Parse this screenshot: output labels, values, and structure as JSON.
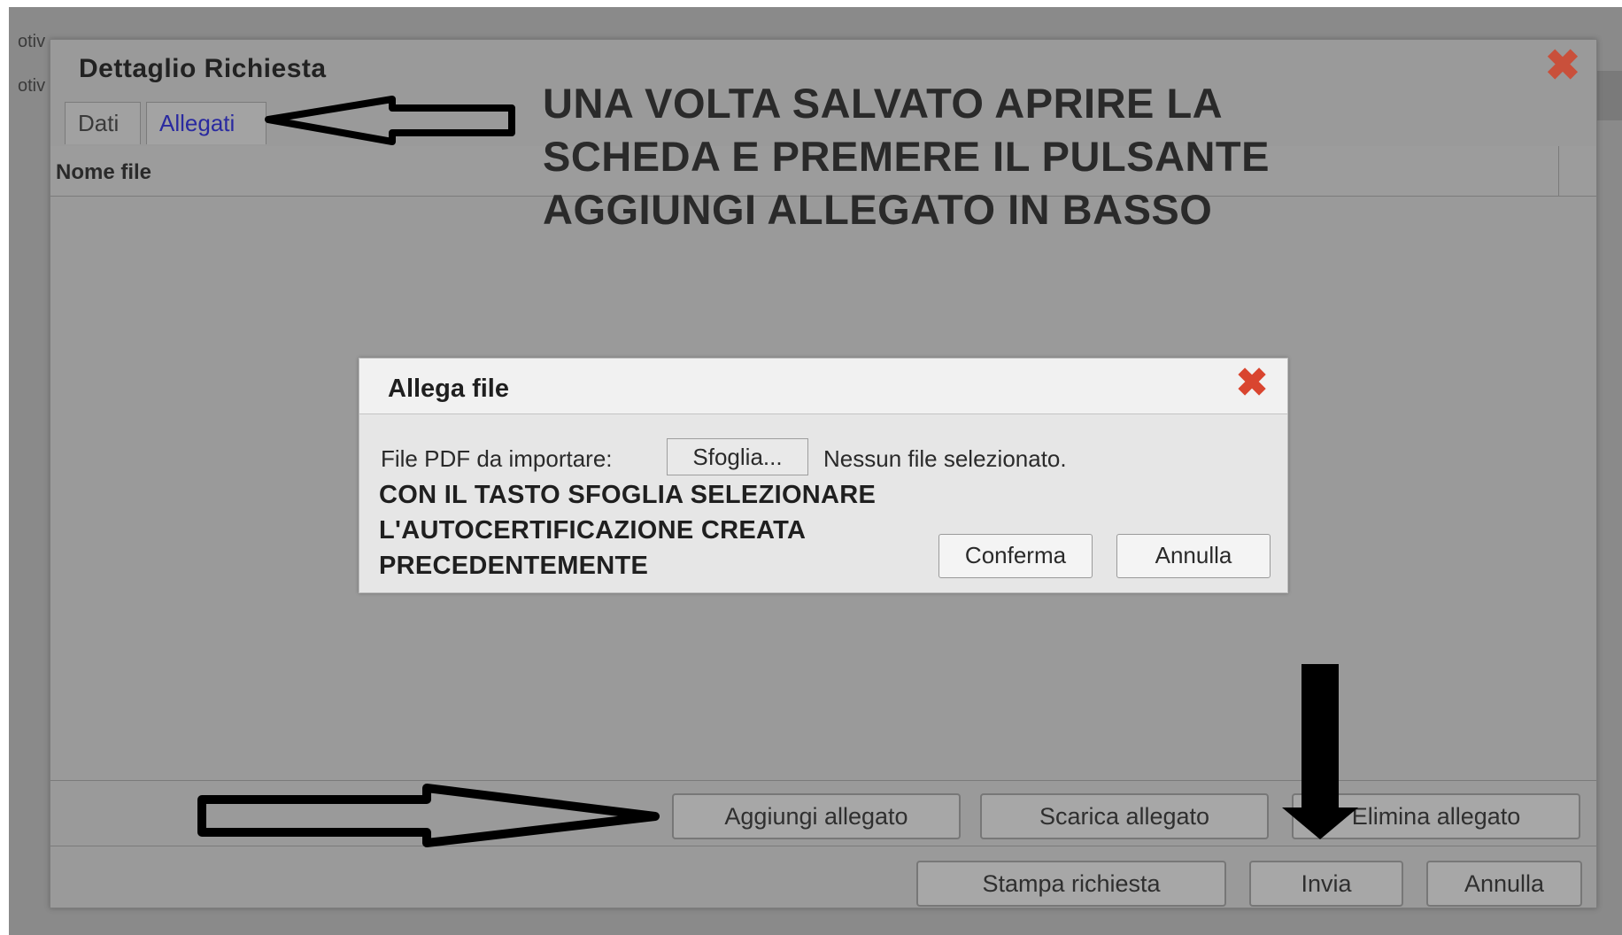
{
  "background": {
    "side_labels": [
      "otiv",
      "otiv"
    ]
  },
  "window": {
    "title": "Dettaglio Richiesta",
    "tabs": [
      {
        "label": "Dati",
        "active": false
      },
      {
        "label": "Allegati",
        "active": true
      }
    ],
    "table": {
      "column_header": "Nome file"
    },
    "instruction_lines": [
      "UNA VOLTA SALVATO APRIRE LA",
      "SCHEDA E PREMERE IL PULSANTE",
      "AGGIUNGI ALLEGATO IN BASSO"
    ],
    "attachment_buttons": {
      "add": "Aggiungi allegato",
      "download": "Scarica allegato",
      "delete": "Elimina allegato"
    },
    "footer_buttons": {
      "print": "Stampa richiesta",
      "send": "Invia",
      "cancel": "Annulla"
    }
  },
  "modal": {
    "title": "Allega file",
    "file_label": "File PDF da importare:",
    "browse_button": "Sfoglia...",
    "file_status": "Nessun file selezionato.",
    "note_lines": [
      "CON IL TASTO SFOGLIA SELEZIONARE",
      "L'AUTOCERTIFICAZIONE CREATA",
      "PRECEDENTEMENTE"
    ],
    "confirm_button": "Conferma",
    "cancel_button": "Annulla"
  },
  "colors": {
    "close_icon": "#c9503b",
    "active_tab_text": "#2a2aa0",
    "annotation_arrow": "#000000"
  },
  "icons": {
    "window_close": "close-icon",
    "modal_close": "close-icon",
    "annotations": [
      "arrow-left-icon",
      "arrow-right-icon",
      "arrow-down-icon"
    ]
  }
}
